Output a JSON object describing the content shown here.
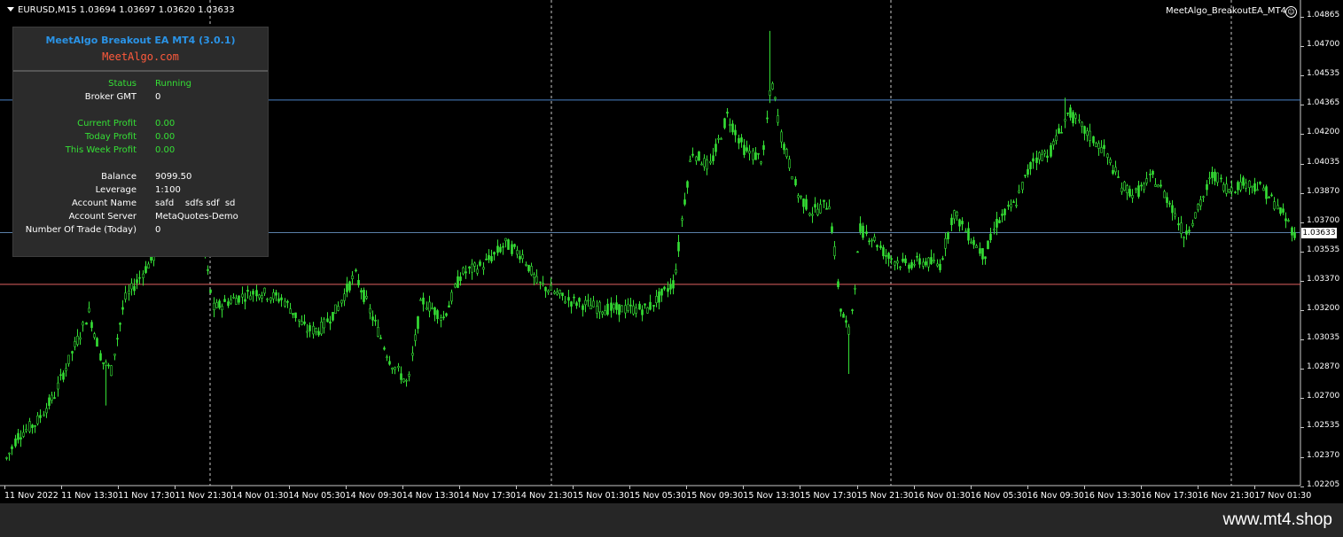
{
  "header": {
    "symbol_info": "EURUSD,M15  1.03694 1.03697 1.03620 1.03633",
    "ea_name": "MeetAlgo_BreakoutEA_MT4"
  },
  "panel": {
    "title": "MeetAlgo Breakout EA MT4 (3.0.1)",
    "site": "MeetAlgo.com",
    "rows": [
      {
        "label": "Status",
        "value": "Running",
        "color": "green"
      },
      {
        "label": "Broker GMT",
        "value": "0",
        "color": "white"
      },
      {
        "label": "Current Profit",
        "value": "0.00",
        "color": "green"
      },
      {
        "label": "Today Profit",
        "value": "0.00",
        "color": "green"
      },
      {
        "label": "This Week Profit",
        "value": "0.00",
        "color": "green"
      },
      {
        "label": "Balance",
        "value": "9099.50",
        "color": "white"
      },
      {
        "label": "Leverage",
        "value": "1:100",
        "color": "white"
      },
      {
        "label": "Account Name",
        "value": "safd    sdfs sdf  sd",
        "color": "white"
      },
      {
        "label": "Account Server",
        "value": "MetaQuotes-Demo",
        "color": "white"
      },
      {
        "label": "Number Of Trade (Today)",
        "value": "0",
        "color": "white"
      }
    ]
  },
  "price_axis": [
    "1.04865",
    "1.04700",
    "1.04535",
    "1.04365",
    "1.04200",
    "1.04035",
    "1.03870",
    "1.03700",
    "1.03535",
    "1.03370",
    "1.03200",
    "1.03035",
    "1.02870",
    "1.02700",
    "1.02535",
    "1.02370",
    "1.02205"
  ],
  "current_price": "1.03633",
  "time_axis": [
    "11 Nov 2022",
    "11 Nov 13:30",
    "11 Nov 17:30",
    "11 Nov 21:30",
    "14 Nov 01:30",
    "14 Nov 05:30",
    "14 Nov 09:30",
    "14 Nov 13:30",
    "14 Nov 17:30",
    "14 Nov 21:30",
    "15 Nov 01:30",
    "15 Nov 05:30",
    "15 Nov 09:30",
    "15 Nov 13:30",
    "15 Nov 17:30",
    "15 Nov 21:30",
    "16 Nov 01:30",
    "16 Nov 05:30",
    "16 Nov 09:30",
    "16 Nov 13:30",
    "16 Nov 17:30",
    "16 Nov 21:30",
    "17 Nov 01:30"
  ],
  "levels": {
    "upper_breakout": 1.04387,
    "lower_breakout": 1.03339,
    "bid": 1.03633,
    "colors": {
      "upper": "#4a84c8",
      "lower": "#e06060",
      "bid": "#5a7fa8",
      "candles": "#35e035",
      "day_separator": "#c8c8c8"
    }
  },
  "watermark": "www.mt4.shop"
}
